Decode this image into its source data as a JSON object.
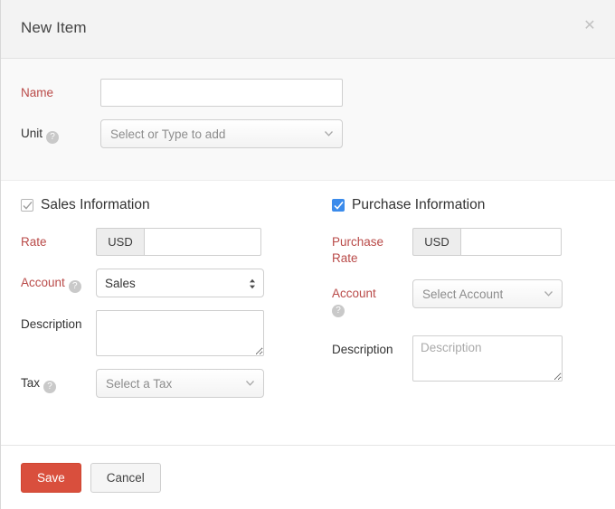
{
  "modal": {
    "title": "New Item",
    "close_icon": "close-icon"
  },
  "top_fields": {
    "name": {
      "label": "Name",
      "required": true,
      "value": "",
      "placeholder": ""
    },
    "unit": {
      "label": "Unit",
      "help_icon": "help-icon",
      "required": false,
      "placeholder": "Select or Type to add",
      "value": ""
    }
  },
  "sales": {
    "checkbox_label": "Sales Information",
    "checked": true,
    "checkbox_style": "grey",
    "rate": {
      "label": "Rate",
      "required": true,
      "currency": "USD",
      "value": "",
      "placeholder": ""
    },
    "account": {
      "label": "Account",
      "help_icon": "help-icon",
      "required": true,
      "selected": "Sales",
      "options": [
        "Sales"
      ]
    },
    "description": {
      "label": "Description",
      "required": false,
      "value": "",
      "placeholder": ""
    },
    "tax": {
      "label": "Tax",
      "help_icon": "help-icon",
      "required": false,
      "placeholder": "Select a Tax",
      "value": ""
    }
  },
  "purchase": {
    "checkbox_label": "Purchase Information",
    "checked": true,
    "checkbox_style": "blue",
    "accent_color": "#3b8beb",
    "rate": {
      "label": "Purchase Rate",
      "required": true,
      "currency": "USD",
      "value": "",
      "placeholder": ""
    },
    "account": {
      "label": "Account",
      "help_icon": "help-icon",
      "required": true,
      "placeholder": "Select Account",
      "value": ""
    },
    "description": {
      "label": "Description",
      "required": false,
      "value": "",
      "placeholder": "Description"
    }
  },
  "footer": {
    "save_label": "Save",
    "cancel_label": "Cancel"
  },
  "colors": {
    "required_label": "#b94a48",
    "save_button": "#d94f3d",
    "checkbox_blue": "#3b8beb",
    "header_bg": "#f3f3f3",
    "top_section_bg": "#f9f9f9"
  }
}
